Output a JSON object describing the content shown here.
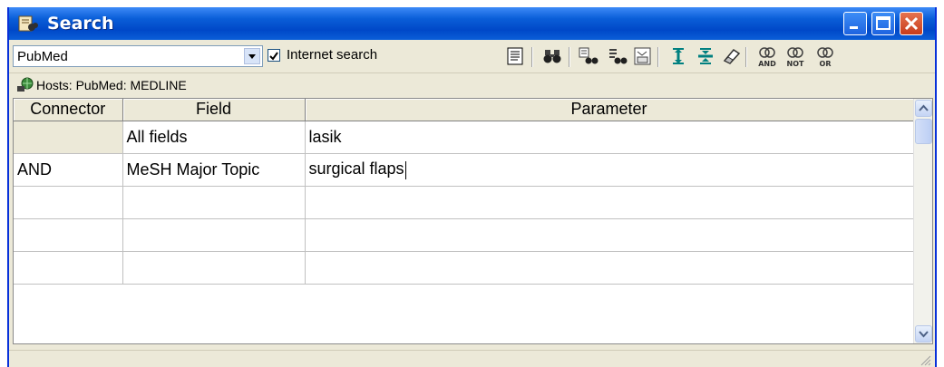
{
  "window": {
    "title": "Search",
    "icons": [
      "binoculars-book-icon",
      "minimize-icon",
      "maximize-icon",
      "close-icon"
    ]
  },
  "toolbar": {
    "database_selected": "PubMed",
    "internet_search_label": "Internet search",
    "internet_search_checked": true,
    "tool_icons": [
      "notepad-icon",
      "binoculars-icon",
      "search-field-icon",
      "search-record-icon",
      "numbered-list-icon",
      "insert-row-icon",
      "delete-row-icon",
      "eraser-icon",
      "and-connector-icon",
      "not-connector-icon",
      "or-connector-icon"
    ],
    "and_label": "AND",
    "not_label": "NOT",
    "or_label": "OR"
  },
  "hosts": {
    "text": "Hosts:  PubMed: MEDLINE",
    "icon": "globe-key-icon"
  },
  "grid": {
    "columns": [
      "Connector",
      "Field",
      "Parameter"
    ],
    "rows": [
      {
        "connector": "",
        "field": "All fields",
        "parameter": "lasik"
      },
      {
        "connector": "AND",
        "field": "MeSH Major Topic",
        "parameter": "surgical flaps"
      },
      {
        "connector": "",
        "field": "",
        "parameter": ""
      },
      {
        "connector": "",
        "field": "",
        "parameter": ""
      },
      {
        "connector": "",
        "field": "",
        "parameter": ""
      }
    ]
  },
  "colors": {
    "title_bar": "#0a5ed8",
    "window_face": "#ece9d8",
    "close_button": "#c83c1c"
  }
}
